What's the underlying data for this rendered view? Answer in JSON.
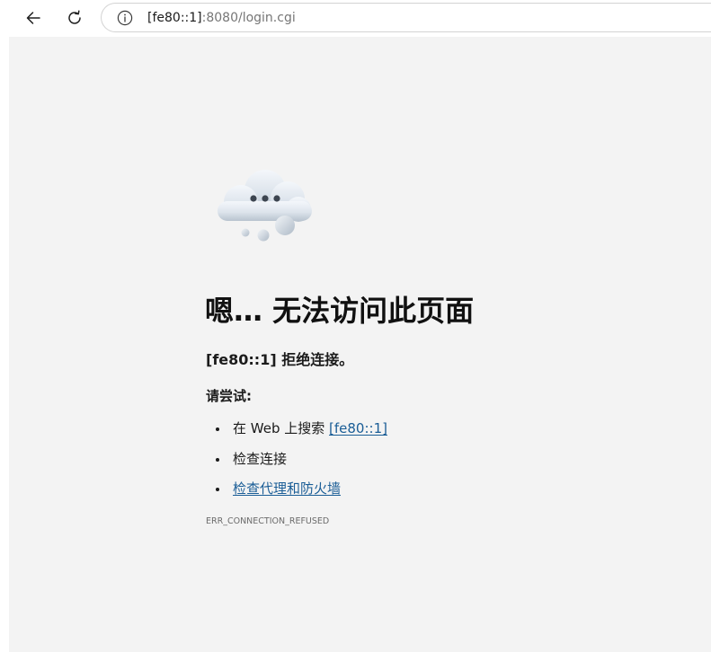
{
  "browser": {
    "url_host": "[fe80::1]",
    "url_rest": ":8080/login.cgi"
  },
  "error": {
    "title": "嗯… 无法访问此页面",
    "subtitle_host": "[fe80::1]",
    "subtitle_text": " 拒绝连接。",
    "try_heading": "请尝试:",
    "suggestion_search_prefix": "在 Web 上搜索 ",
    "suggestion_search_link": "[fe80::1]",
    "suggestion_check_connection": "检查连接",
    "suggestion_check_proxy": "检查代理和防火墙",
    "error_code": "ERR_CONNECTION_REFUSED"
  },
  "colors": {
    "link": "#1a5d96",
    "page_background": "#f3f3f3",
    "toolbar_background": "#ffffff"
  },
  "icons": {
    "back": "arrow-left",
    "refresh": "refresh",
    "site_info": "info-circle",
    "hero": "cloud-with-ellipsis"
  }
}
